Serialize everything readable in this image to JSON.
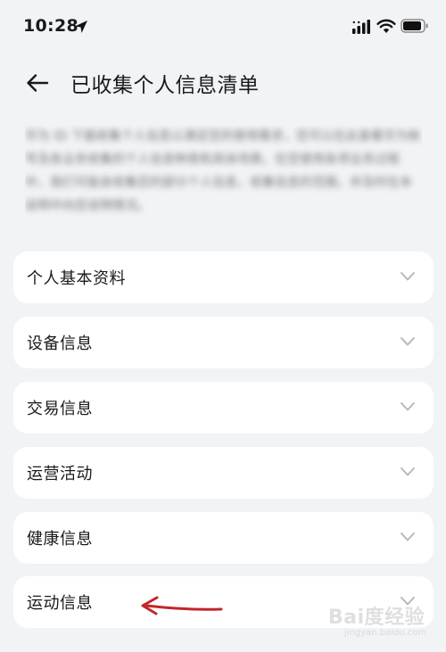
{
  "status_bar": {
    "time": "10:28",
    "icons": [
      "location-arrow-icon",
      "cellular-signal-icon",
      "wifi-icon",
      "battery-icon"
    ]
  },
  "header": {
    "back_icon": "arrow-left-icon",
    "title": "已收集个人信息清单"
  },
  "description": {
    "text": "华为 ID 下面收集个人信息以满足您的使用需求，您可以在此查看华为帐号及各业务收集的个人信息种类和具体场景。在您使用各项业务过程中，我们可能会收集您的部分个人信息，收集信息的范围，并及时在本说明中向您说明情况。"
  },
  "sections": [
    {
      "label": "个人基本资料"
    },
    {
      "label": "设备信息"
    },
    {
      "label": "交易信息"
    },
    {
      "label": "运营活动"
    },
    {
      "label": "健康信息"
    },
    {
      "label": "运动信息"
    }
  ],
  "colors": {
    "background": "#f1f3f5",
    "card": "#ffffff",
    "annotation_arrow": "#c1272d",
    "chevron": "#b8b8b8"
  },
  "watermark": {
    "text": "Bai度经验",
    "url": "jingyan.baidu.com"
  }
}
